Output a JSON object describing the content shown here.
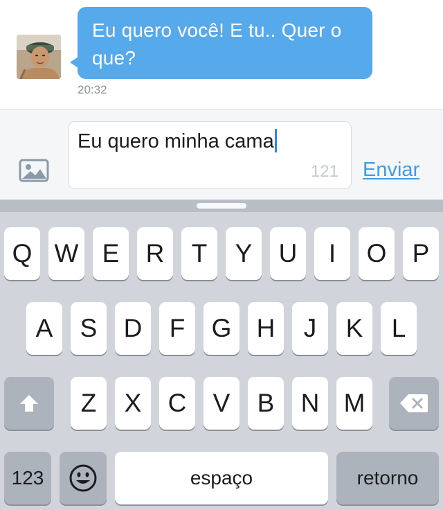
{
  "conversation": {
    "message": {
      "text": "Eu quero você! E tu.. Quer o que?",
      "time": "20:32"
    },
    "avatar_icon": "user-avatar-photo"
  },
  "composer": {
    "photo_icon": "image-icon",
    "input_value": "Eu quero minha cama",
    "char_count": "121",
    "send_label": "Enviar"
  },
  "colors": {
    "bubble": "#56a9ea",
    "accent": "#3f9ce6",
    "keyboard_bg": "#d1d5db"
  },
  "keyboard": {
    "row1": [
      "Q",
      "W",
      "E",
      "R",
      "T",
      "Y",
      "U",
      "I",
      "O",
      "P"
    ],
    "row2": [
      "A",
      "S",
      "D",
      "F",
      "G",
      "H",
      "J",
      "K",
      "L"
    ],
    "row3": [
      "Z",
      "X",
      "C",
      "V",
      "B",
      "N",
      "M"
    ],
    "shift_icon": "shift-arrow-icon",
    "delete_icon": "backspace-icon",
    "numbers_label": "123",
    "emoji_icon": "emoji-smiley-icon",
    "space_label": "espaço",
    "return_label": "retorno"
  }
}
